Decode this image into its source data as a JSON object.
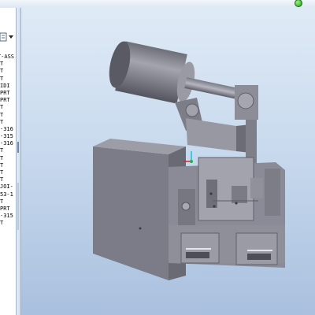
{
  "app": {
    "status_indicator": "green"
  },
  "model_tree": {
    "toolbar": {
      "icon": "model-tree-icon",
      "dropdown_icon": "chevron-down-icon"
    },
    "items": [
      "T-ASS",
      "T",
      "T",
      "T",
      "IDI",
      "PRT",
      "PRT",
      "T",
      "T",
      "T",
      "316-",
      "315-",
      "316-",
      "T",
      "T",
      "T",
      "T",
      "T",
      "-JOI",
      "53-1",
      "T",
      "PRT",
      "315-",
      "T"
    ]
  },
  "viewport": {
    "content": "3D assembly model",
    "colors": {
      "model": "#8a8a96",
      "background_top": "#dfeaf6",
      "background_bottom": "#a9c0de"
    }
  }
}
